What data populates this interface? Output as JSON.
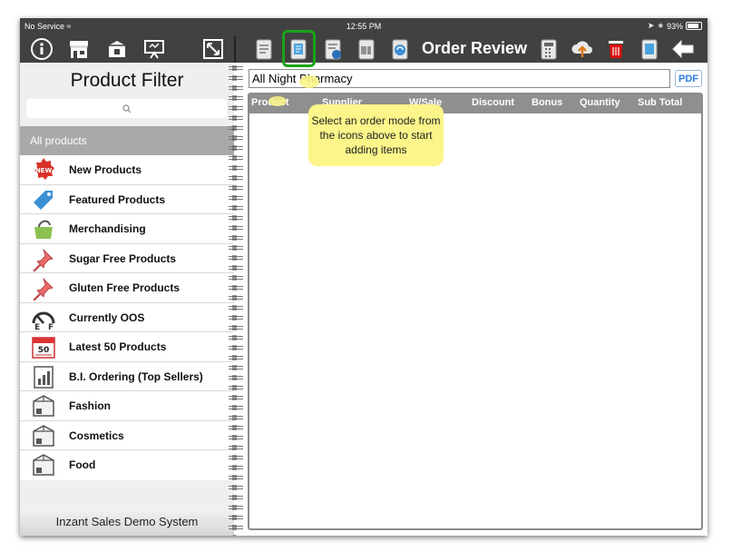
{
  "status_bar": {
    "carrier": "No Service",
    "time": "12:55 PM",
    "battery": "93%"
  },
  "toolbar": {
    "title": "Order Review",
    "left_icons": [
      "info-icon",
      "store-icon",
      "box-icon",
      "presentation-icon",
      "resize-icon"
    ],
    "right_icons": [
      "order-sheet-icon",
      "tablet-order-icon",
      "scanner-order-icon",
      "barcode-order-icon",
      "sync-order-icon",
      "calculator-icon",
      "upload-cloud-icon",
      "trash-icon",
      "copy-order-icon",
      "back-arrow-icon"
    ]
  },
  "product_filter": {
    "title": "Product Filter",
    "all_products_label": "All products",
    "items": [
      {
        "label": "New Products",
        "icon": "new-badge-icon"
      },
      {
        "label": "Featured Products",
        "icon": "tag-icon"
      },
      {
        "label": "Merchandising",
        "icon": "bag-icon"
      },
      {
        "label": "Sugar Free Products",
        "icon": "pushpin-icon"
      },
      {
        "label": "Gluten Free Products",
        "icon": "pushpin-icon"
      },
      {
        "label": "Currently OOS",
        "icon": "fuel-gauge-icon"
      },
      {
        "label": "Latest 50 Products",
        "icon": "calendar-icon"
      },
      {
        "label": "B.I. Ordering (Top Sellers)",
        "icon": "bar-chart-icon"
      },
      {
        "label": "Fashion",
        "icon": "box-icon"
      },
      {
        "label": "Cosmetics",
        "icon": "box-icon"
      },
      {
        "label": "Food",
        "icon": "box-icon"
      }
    ],
    "footer": "Inzant Sales Demo System"
  },
  "order": {
    "customer": "All Night Pharmacy",
    "pdf_label": "PDF",
    "columns": [
      "Product",
      "Supplier",
      "W/Sale",
      "Discount",
      "Bonus",
      "Quantity",
      "Sub Total"
    ],
    "tooltip": "Select an order mode from the icons above to start adding items"
  },
  "colors": {
    "toolbar_bg": "#414141",
    "highlight": "#1aa31a",
    "tooltip_bg": "#fbf58a",
    "header_bg": "#8f8f8f",
    "pdf_blue": "#2a7be0"
  }
}
